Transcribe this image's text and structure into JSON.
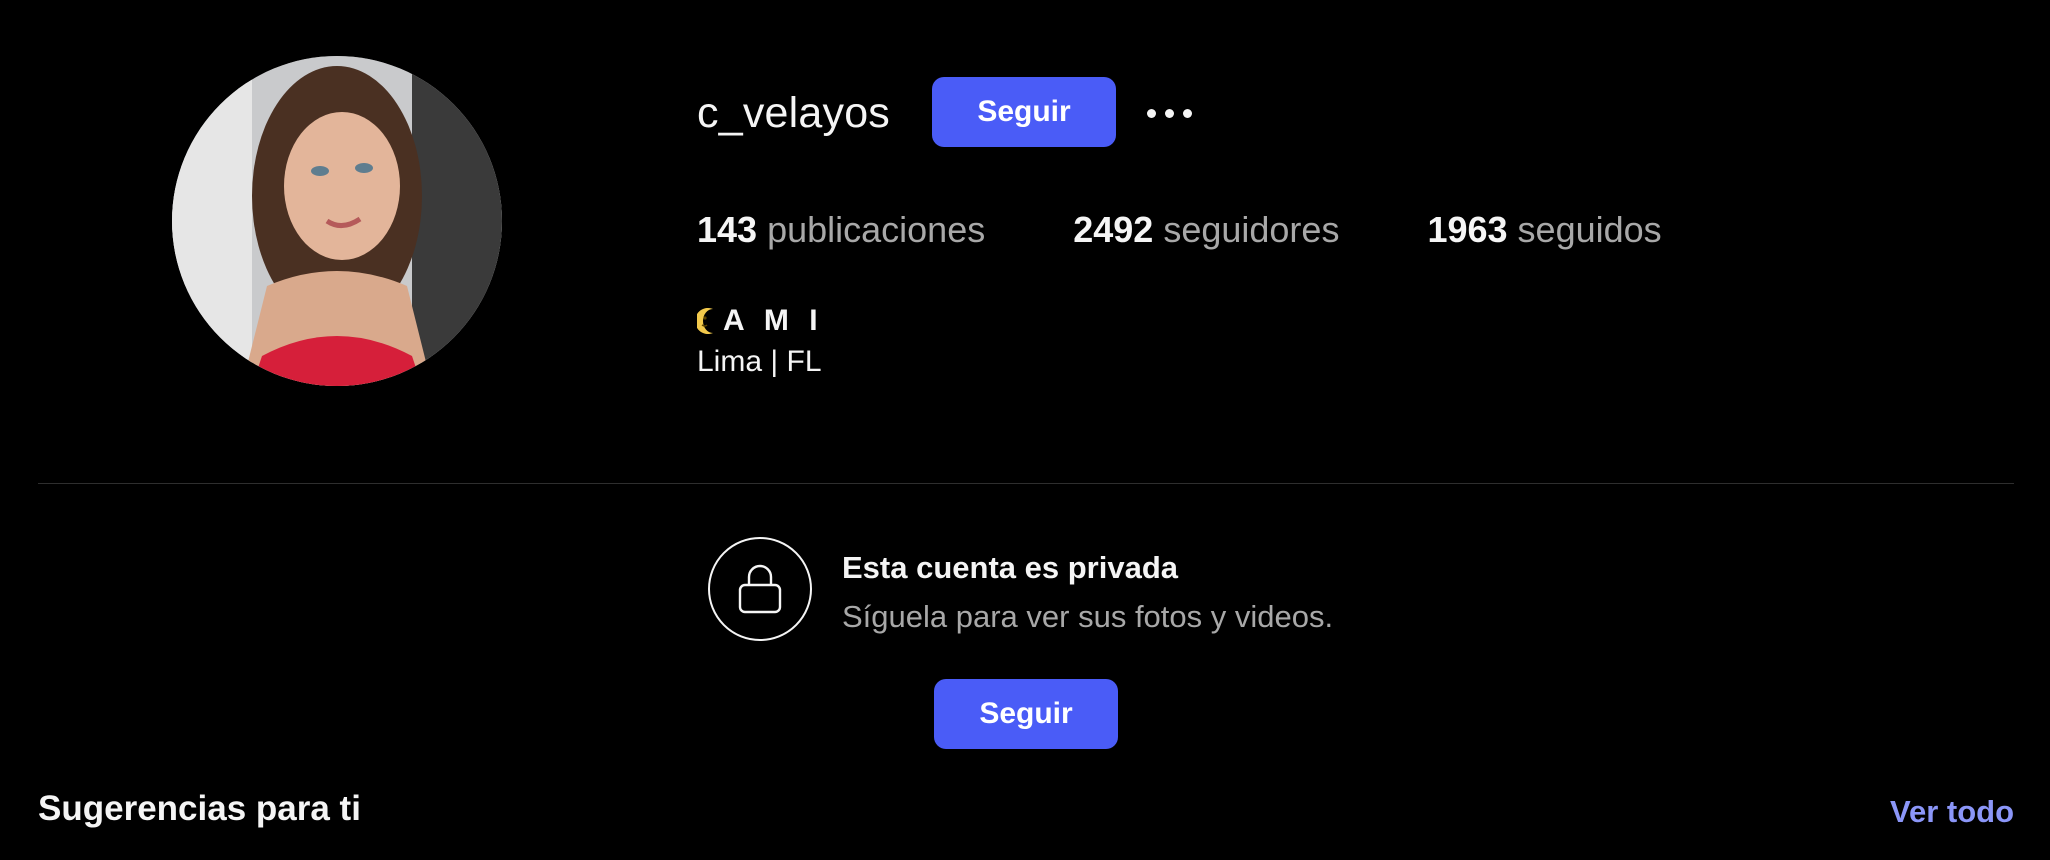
{
  "profile": {
    "username": "c_velayos",
    "follow_label": "Seguir",
    "more_icon": "more-horizontal-icon",
    "avatar_icon": "profile-photo"
  },
  "stats": [
    {
      "count": "143",
      "label": "publicaciones"
    },
    {
      "count": "2492",
      "label": "seguidores"
    },
    {
      "count": "1963",
      "label": "seguidos"
    }
  ],
  "bio": {
    "name": "A M I",
    "name_icon": "crescent-moon-face-icon",
    "location": "Lima | FL"
  },
  "private": {
    "icon": "lock-icon",
    "title": "Esta cuenta es privada",
    "subtitle": "Síguela para ver sus fotos y videos.",
    "follow_label": "Seguir"
  },
  "suggestions": {
    "title": "Sugerencias para ti",
    "see_all_label": "Ver todo"
  },
  "colors": {
    "background": "#000000",
    "primary_button": "#4a5cf7",
    "link": "#8b96f8",
    "secondary_text": "#a8a8a8"
  }
}
